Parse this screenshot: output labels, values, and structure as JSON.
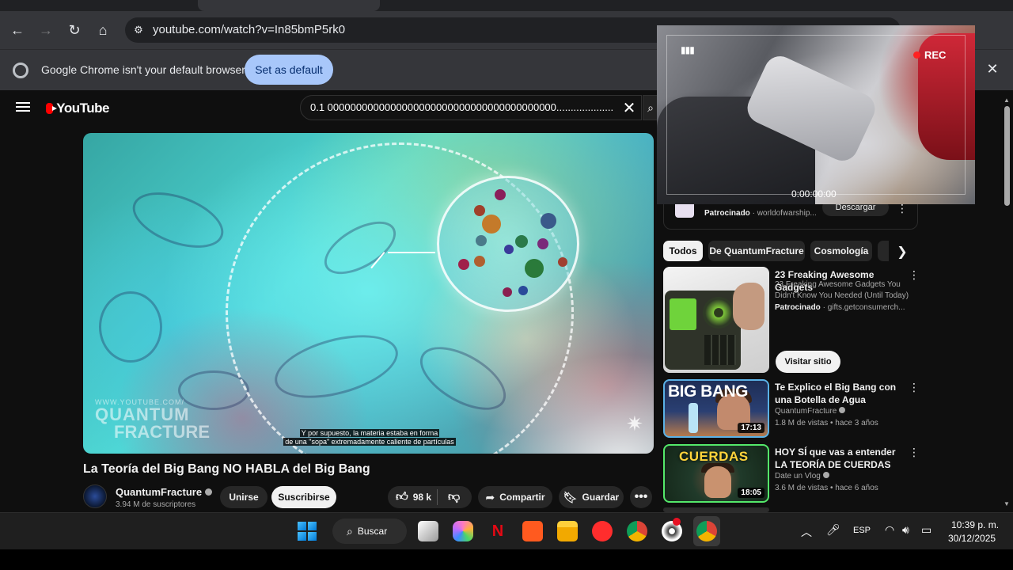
{
  "browser": {
    "url": "youtube.com/watch?v=In85bmP5rk0",
    "infobar_text": "Google Chrome isn't your default browser",
    "set_default_label": "Set as default"
  },
  "youtube": {
    "logo_text": "YouTube",
    "search_value": "0.1 0000000000000000000000000000000000000000.........................",
    "video": {
      "title": "La Teoría del Big Bang NO HABLA del Big Bang",
      "watermark_small": "WWW.YOUTUBE.COM/",
      "watermark_line1": "QUANTUM",
      "watermark_line2": "FRACTURE",
      "subtitle_line1": "Y por supuesto, la materia estaba en forma",
      "subtitle_line2": "de una \"sopa\" extremadamente caliente de partículas"
    },
    "channel": {
      "name": "QuantumFracture",
      "subscribers": "3.94 M de suscriptores"
    },
    "actions": {
      "join": "Unirse",
      "subscribe": "Suscribirse",
      "likes": "98 k",
      "share": "Compartir",
      "save": "Guardar"
    },
    "ad": {
      "sponsored": "Patrocinado",
      "domain": "worldofwarship...",
      "download": "Descargar"
    },
    "chips": [
      "Todos",
      "De QuantumFracture",
      "Cosmología"
    ],
    "recommendations": [
      {
        "title": "23 Freaking Awesome Gadgets",
        "description": "23 Freaking Awesome Gadgets You Didn't Know You Needed (Until Today)",
        "sponsored": "Patrocinado",
        "domain": "gifts.getconsumerch...",
        "cta": "Visitar sitio"
      },
      {
        "title": "Te Explico el Big Bang con una Botella de Agua",
        "channel": "QuantumFracture",
        "meta": "1.8 M de vistas • hace 3 años",
        "duration": "17:13",
        "thumb_text": "BIG BANG"
      },
      {
        "title": "HOY SÍ que vas a entender LA TEORÍA DE CUERDAS",
        "channel": "Date un Vlog",
        "meta": "3.6 M de vistas • hace 6 años",
        "duration": "18:05",
        "thumb_text": "CUERDAS"
      }
    ]
  },
  "webcam": {
    "battery": "▮▮▮",
    "rec_label": "REC",
    "timecode": "0:00:00:00"
  },
  "taskbar": {
    "search_label": "Buscar",
    "language": "ESP",
    "time": "10:39 p. m.",
    "date": "30/12/2025"
  },
  "colors": {
    "accent_blue": "#a8c7fa",
    "youtube_red": "#ff0000",
    "rec_red": "#ff2222"
  }
}
